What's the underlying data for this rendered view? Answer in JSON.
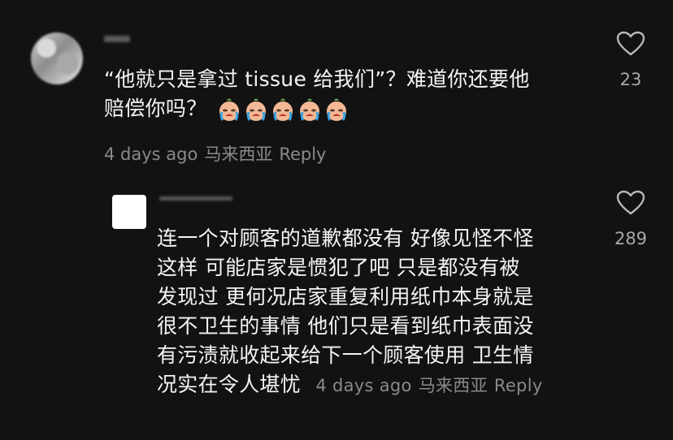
{
  "comments": [
    {
      "text_line1": "“他就只是拿过 tissue 给我们”？难道你还要他",
      "text_line2": "赔偿你吗？",
      "emoji_names": [
        "crying-face-icon",
        "crying-face-icon",
        "crying-face-icon",
        "crying-face-icon",
        "crying-face-icon"
      ],
      "time": "4 days ago",
      "location": "马来西亚",
      "reply_label": "Reply",
      "likes": "23"
    },
    {
      "text_lines": [
        "连一个对顾客的道歉都没有 好像见怪不怪",
        "这样 可能店家是惯犯了吧 只是都没有被",
        "发现过 更何况店家重复利用纸巾本身就是",
        "很不卫生的事情 他们只是看到纸巾表面没",
        "有污渍就收起来给下一个顾客使用 卫生情"
      ],
      "last_line": "况实在令人堪忧",
      "time": "4 days ago",
      "location": "马来西亚",
      "reply_label": "Reply",
      "likes": "289"
    }
  ],
  "colors": {
    "background": "#121212",
    "text": "#f4f4f4",
    "meta": "#8a8a8a"
  }
}
